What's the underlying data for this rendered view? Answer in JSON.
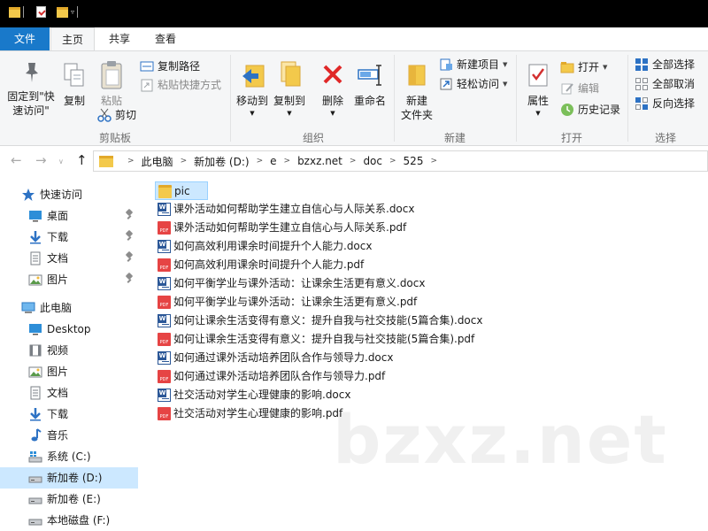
{
  "window": {
    "background_color": "#000000",
    "accent_color": "#1979ca",
    "quick_access_icons": [
      "folder-icon",
      "properties-icon",
      "new-folder-icon",
      "customize-chevron-icon"
    ]
  },
  "tabs": [
    {
      "id": "file",
      "label": "文件"
    },
    {
      "id": "home",
      "label": "主页"
    },
    {
      "id": "share",
      "label": "共享"
    },
    {
      "id": "view",
      "label": "查看"
    }
  ],
  "ribbon": {
    "clipboard": {
      "label": "剪贴板",
      "pin": {
        "line1": "固定到\"快",
        "line2": "速访问\""
      },
      "copy": "复制",
      "paste": "粘贴",
      "copy_path": "复制路径",
      "paste_shortcut": "粘贴快捷方式",
      "cut": "剪切"
    },
    "organize": {
      "label": "组织",
      "move_to": "移动到",
      "copy_to": "复制到",
      "delete": "删除",
      "rename": "重命名"
    },
    "new": {
      "label": "新建",
      "new_folder": {
        "line1": "新建",
        "line2": "文件夹"
      },
      "new_item": "新建项目",
      "easy_access": "轻松访问"
    },
    "open": {
      "label": "打开",
      "properties": "属性",
      "open": "打开",
      "edit": "编辑",
      "history": "历史记录"
    },
    "select": {
      "label": "选择",
      "select_all": "全部选择",
      "select_none": "全部取消",
      "invert": "反向选择"
    }
  },
  "address": {
    "crumbs": [
      "此电脑",
      "新加卷 (D:)",
      "e",
      "bzxz.net",
      "doc",
      "525"
    ]
  },
  "nav_pane": [
    {
      "label": "快速访问",
      "icon": "star-icon",
      "level": 0,
      "pinned": false
    },
    {
      "label": "桌面",
      "icon": "desktop-icon",
      "level": 1,
      "pinned": true
    },
    {
      "label": "下载",
      "icon": "download-icon",
      "level": 1,
      "pinned": true
    },
    {
      "label": "文档",
      "icon": "documents-icon",
      "level": 1,
      "pinned": true
    },
    {
      "label": "图片",
      "icon": "pictures-icon",
      "level": 1,
      "pinned": true
    },
    {
      "label": "此电脑",
      "icon": "computer-icon",
      "level": 0,
      "pinned": false
    },
    {
      "label": "Desktop",
      "icon": "desktop-icon",
      "level": 1,
      "pinned": false
    },
    {
      "label": "视频",
      "icon": "videos-icon",
      "level": 1,
      "pinned": false
    },
    {
      "label": "图片",
      "icon": "pictures-icon",
      "level": 1,
      "pinned": false
    },
    {
      "label": "文档",
      "icon": "documents-icon",
      "level": 1,
      "pinned": false
    },
    {
      "label": "下载",
      "icon": "download-icon",
      "level": 1,
      "pinned": false
    },
    {
      "label": "音乐",
      "icon": "music-icon",
      "level": 1,
      "pinned": false
    },
    {
      "label": "系统 (C:)",
      "icon": "drive-icon",
      "level": 1,
      "pinned": false
    },
    {
      "label": "新加卷 (D:)",
      "icon": "drive-icon",
      "level": 1,
      "pinned": false,
      "selected": true
    },
    {
      "label": "新加卷 (E:)",
      "icon": "drive-icon",
      "level": 1,
      "pinned": false
    },
    {
      "label": "本地磁盘 (F:)",
      "icon": "drive-icon",
      "level": 1,
      "pinned": false
    }
  ],
  "files": [
    {
      "name": "pic",
      "type": "folder",
      "selected": true
    },
    {
      "name": "课外活动如何帮助学生建立自信心与人际关系.docx",
      "type": "docx"
    },
    {
      "name": "课外活动如何帮助学生建立自信心与人际关系.pdf",
      "type": "pdf"
    },
    {
      "name": "如何高效利用课余时间提升个人能力.docx",
      "type": "docx"
    },
    {
      "name": "如何高效利用课余时间提升个人能力.pdf",
      "type": "pdf"
    },
    {
      "name": "如何平衡学业与课外活动：让课余生活更有意义.docx",
      "type": "docx"
    },
    {
      "name": "如何平衡学业与课外活动：让课余生活更有意义.pdf",
      "type": "pdf"
    },
    {
      "name": "如何让课余生活变得有意义：提升自我与社交技能(5篇合集).docx",
      "type": "docx"
    },
    {
      "name": "如何让课余生活变得有意义：提升自我与社交技能(5篇合集).pdf",
      "type": "pdf"
    },
    {
      "name": "如何通过课外活动培养团队合作与领导力.docx",
      "type": "docx"
    },
    {
      "name": "如何通过课外活动培养团队合作与领导力.pdf",
      "type": "pdf"
    },
    {
      "name": "社交活动对学生心理健康的影响.docx",
      "type": "docx"
    },
    {
      "name": "社交活动对学生心理健康的影响.pdf",
      "type": "pdf"
    }
  ],
  "watermark": "bzxz.net"
}
